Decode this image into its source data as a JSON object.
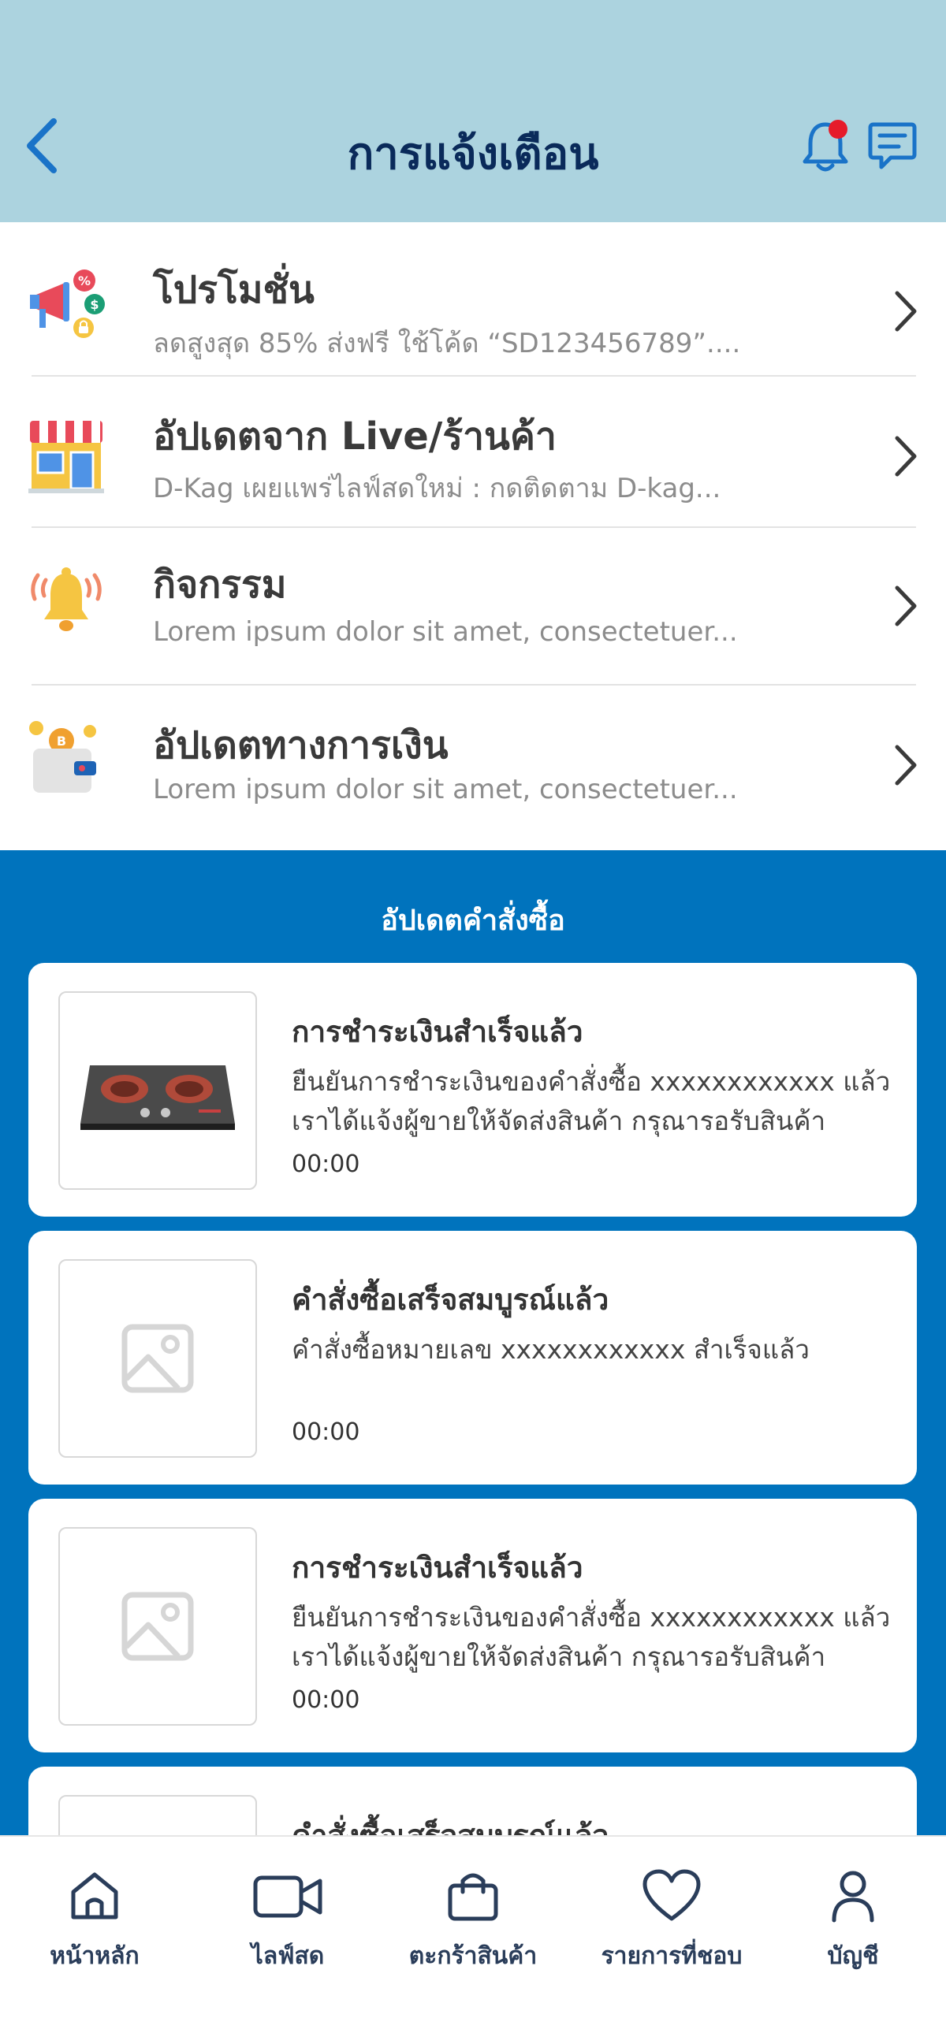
{
  "header": {
    "title": "การแจ้งเตือน",
    "back_icon": "chevron-left-icon",
    "bell_icon": "bell-icon",
    "chat_icon": "chat-icon",
    "accent_color": "#1a73c8",
    "badge_color": "#e61b2a"
  },
  "categories": [
    {
      "title": "โปรโมชั่น",
      "subtitle": "ลดสูงสุด 85% ส่งฟรี ใช้โค้ด “SD123456789”....",
      "icon": "megaphone-promo-icon"
    },
    {
      "title": "อัปเดตจาก Live/ร้านค้า",
      "subtitle": "D-Kag เผยแพร่ไลฟ์สดใหม่ : กดติดตาม D-kag...",
      "icon": "shop-icon"
    },
    {
      "title": "กิจกรรม",
      "subtitle": "Lorem ipsum dolor sit amet, consectetuer...",
      "icon": "ringing-bell-icon"
    },
    {
      "title": "อัปเดตทางการเงิน",
      "subtitle": "Lorem ipsum dolor sit amet, consectetuer...",
      "icon": "wallet-coin-icon"
    }
  ],
  "orders": {
    "section_title": "อัปเดตคำสั่งซื้อ",
    "background": "#0073bd",
    "items": [
      {
        "title": "การชำระเงินสำเร็จแล้ว",
        "desc": "ยืนยันการชำระเงินของคำสั่งซื้อ xxxxxxxxxxxx แล้ว เราได้แจ้งผู้ขายให้จัดส่งสินค้า กรุณารอรับสินค้า",
        "time": "00:00",
        "image": "gas-stove-image"
      },
      {
        "title": "คำสั่งซื้อเสร็จสมบูรณ์แล้ว",
        "desc": "คำสั่งซื้อหมายเลข xxxxxxxxxxxx สำเร็จแล้ว",
        "time": "00:00",
        "image": "image-placeholder-icon"
      },
      {
        "title": "การชำระเงินสำเร็จแล้ว",
        "desc": "ยืนยันการชำระเงินของคำสั่งซื้อ xxxxxxxxxxxx แล้ว เราได้แจ้งผู้ขายให้จัดส่งสินค้า กรุณารอรับสินค้า",
        "time": "00:00",
        "image": "image-placeholder-icon"
      },
      {
        "title": "คำสั่งซื้อเสร็จสมบูรณ์แล้ว",
        "desc": "",
        "time": "",
        "image": "image-placeholder-icon"
      }
    ]
  },
  "nav": [
    {
      "label": "หน้าหลัก",
      "icon": "home-icon"
    },
    {
      "label": "ไลฟ์สด",
      "icon": "video-camera-icon"
    },
    {
      "label": "ตะกร้าสินค้า",
      "icon": "shopping-bag-icon"
    },
    {
      "label": "รายการที่ชอบ",
      "icon": "heart-icon"
    },
    {
      "label": "บัญชี",
      "icon": "user-icon"
    }
  ]
}
